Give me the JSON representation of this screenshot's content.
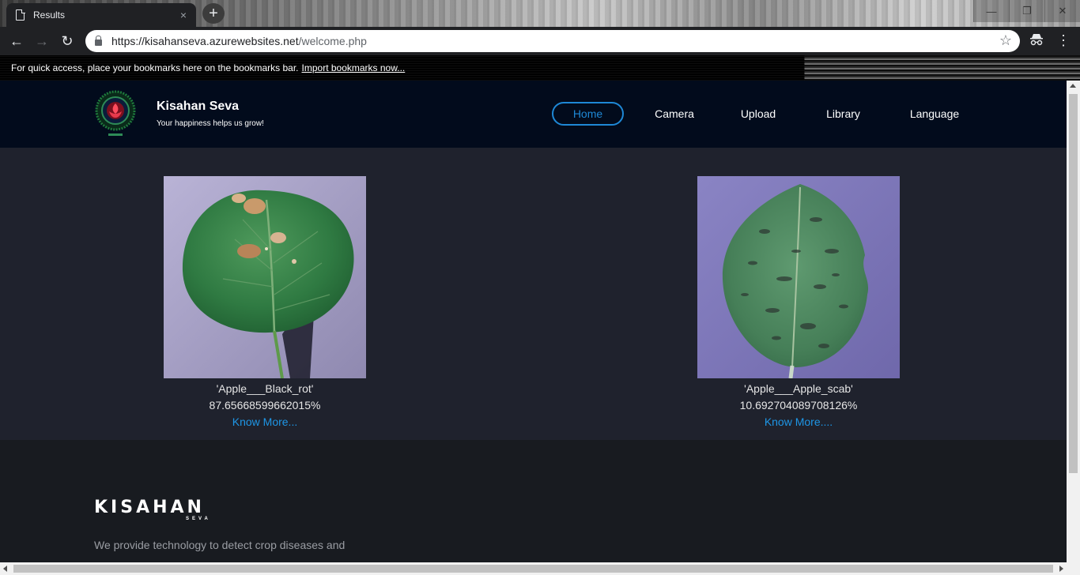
{
  "browser": {
    "tab_title": "Results",
    "tab_close": "×",
    "new_tab": "+",
    "back": "←",
    "forward": "→",
    "reload": "↻",
    "url_host": "https://kisahanseva.azurewebsites.net",
    "url_path": "/welcome.php",
    "star": "☆",
    "menu": "⋮",
    "incognito": "🕶",
    "window_controls": {
      "minimize": "—",
      "maximize": "❐",
      "close": "✕"
    },
    "bookmarks_prompt": "For quick access, place your bookmarks here on the bookmarks bar.",
    "import_bookmarks": "Import bookmarks now..."
  },
  "header": {
    "title": "Kisahan Seva",
    "tagline": "Your happiness helps us grow!",
    "nav": [
      {
        "label": "Home",
        "active": true
      },
      {
        "label": "Camera",
        "active": false
      },
      {
        "label": "Upload",
        "active": false
      },
      {
        "label": "Library",
        "active": false
      },
      {
        "label": "Language",
        "active": false
      }
    ]
  },
  "results": [
    {
      "disease": "'Apple___Black_rot'",
      "confidence": "87.65668599662015%",
      "link": "Know More..."
    },
    {
      "disease": "'Apple___Apple_scab'",
      "confidence": "10.692704089708126%",
      "link": "Know More...."
    }
  ],
  "footer": {
    "logo_main": "KISAHAN",
    "logo_sub": "SEVA",
    "description": "We provide technology to detect crop diseases and"
  },
  "colors": {
    "header_bg": "#020b1c",
    "results_bg": "#1f222d",
    "footer_bg": "#181b20",
    "accent": "#1e88d6",
    "link": "#1e96e6"
  }
}
